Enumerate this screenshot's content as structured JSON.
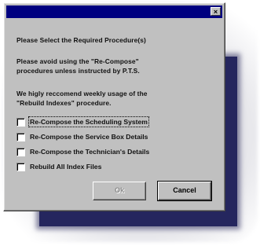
{
  "dialog": {
    "close_glyph": "×",
    "heading": "Please Select the Required Procedure(s)",
    "warning_lines": [
      "Please avoid using the \"Re-Compose\"",
      "procedures unless instructed by P.T.S."
    ],
    "recommend_lines": [
      "We higly reccomend weekly usage of the",
      "\"Rebuild Indexes\" procedure."
    ],
    "options": [
      {
        "label": "Re-Compose the Scheduling System",
        "checked": false
      },
      {
        "label": "Re-Compose the Service Box Details",
        "checked": false
      },
      {
        "label": "Re-Compose the Technician's Details",
        "checked": false
      },
      {
        "label": "Rebuild All Index Files",
        "checked": false
      }
    ],
    "buttons": {
      "ok_label": "Ok",
      "ok_enabled": false,
      "cancel_label": "Cancel"
    }
  }
}
